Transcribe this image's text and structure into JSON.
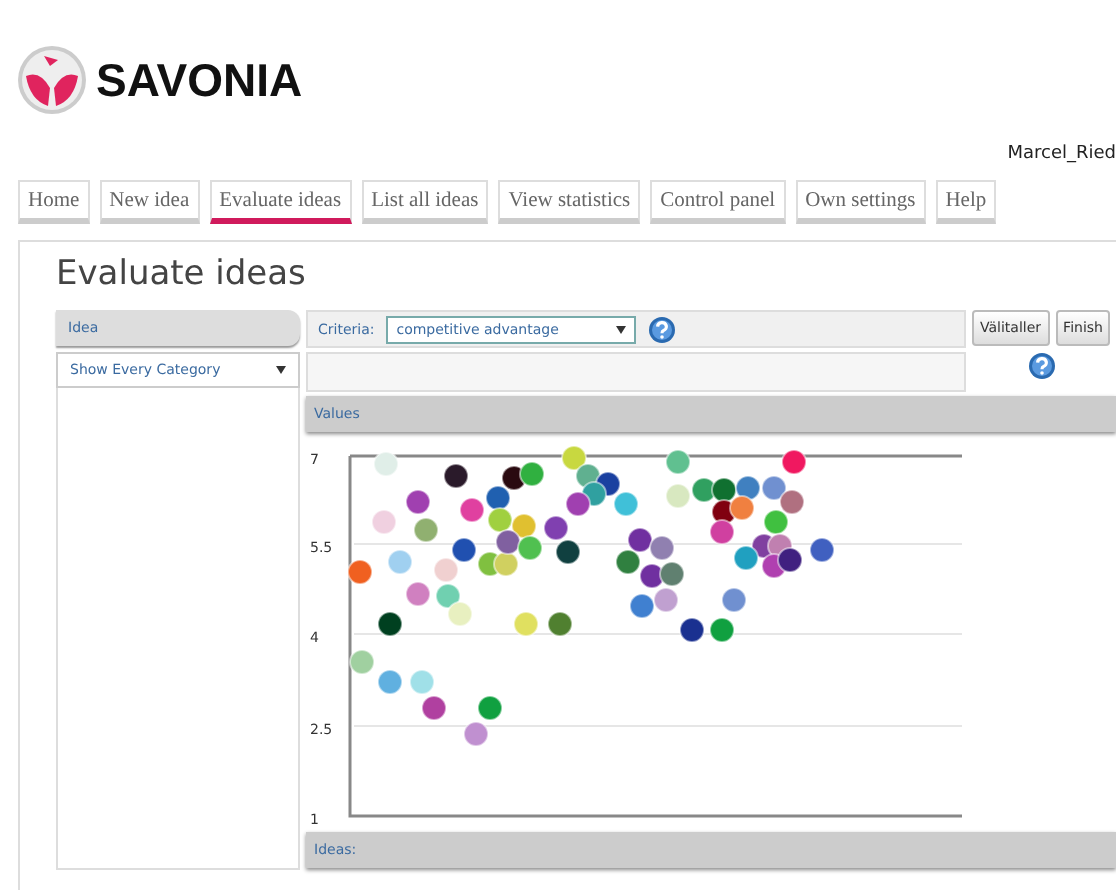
{
  "brand": {
    "name": "SAVONIA"
  },
  "user": {
    "name": "Marcel_Ried"
  },
  "tabs": [
    {
      "label": "Home",
      "selected": false
    },
    {
      "label": "New idea",
      "selected": false
    },
    {
      "label": "Evaluate ideas",
      "selected": true
    },
    {
      "label": "List all ideas",
      "selected": false
    },
    {
      "label": "View statistics",
      "selected": false
    },
    {
      "label": "Control panel",
      "selected": false
    },
    {
      "label": "Own settings",
      "selected": false
    },
    {
      "label": "Help",
      "selected": false
    }
  ],
  "page_title": "Evaluate ideas",
  "idea_panel": {
    "header": "Idea",
    "category_select": "Show Every Category"
  },
  "criteria": {
    "label": "Criteria:",
    "value": "competitive advantage"
  },
  "buttons": [
    "Välitaller",
    "Finish"
  ],
  "values_header": "Values",
  "y_tick_labels": [
    "7",
    "5.5",
    "4",
    "2.5",
    "1"
  ],
  "ideas_footer": "Ideas:"
}
